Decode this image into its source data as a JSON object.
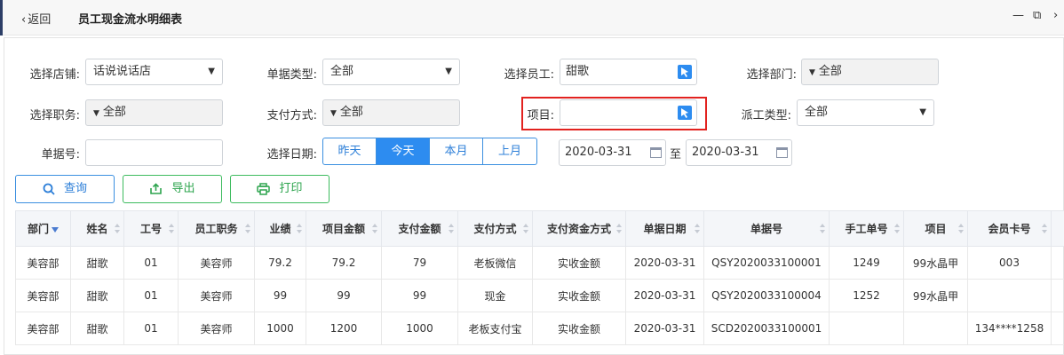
{
  "header": {
    "back_label": "返回",
    "title": "员工现金流水明细表",
    "minimize_glyph": "—",
    "restore_glyph": "⧉",
    "close_glyph": "›"
  },
  "filters": {
    "store_label": "选择店铺:",
    "store_value": "话说说话店",
    "doc_type_label": "单据类型:",
    "doc_type_value": "全部",
    "employee_label": "选择员工:",
    "employee_value": "甜歌",
    "dept_label": "选择部门:",
    "dept_value": "全部",
    "position_label": "选择职务:",
    "position_value": "全部",
    "pay_method_label": "支付方式:",
    "pay_method_value": "全部",
    "item_label": "项目:",
    "item_value": "",
    "dispatch_label": "派工类型:",
    "dispatch_value": "全部",
    "doc_no_label": "单据号:",
    "doc_no_value": "",
    "date_label": "选择日期:",
    "date_tabs": [
      "昨天",
      "今天",
      "本月",
      "上月"
    ],
    "date_active": "今天",
    "date_from": "2020-03-31",
    "date_to_sep": "至",
    "date_to": "2020-03-31",
    "accent_color": "#2d8cf0",
    "highlight_color": "#e2221f"
  },
  "actions": {
    "query_label": "查询",
    "export_label": "导出",
    "print_label": "打印"
  },
  "table": {
    "columns": [
      "部门",
      "姓名",
      "工号",
      "员工职务",
      "业绩",
      "项目金额",
      "支付金额",
      "支付方式",
      "支付资金方式",
      "单据日期",
      "单据号",
      "手工单号",
      "项目",
      "会员卡号"
    ],
    "rows": [
      [
        "美容部",
        "甜歌",
        "01",
        "美容师",
        "79.2",
        "79.2",
        "79",
        "老板微信",
        "实收金额",
        "2020-03-31",
        "QSY2020033100001",
        "1249",
        "99水晶甲",
        "003"
      ],
      [
        "美容部",
        "甜歌",
        "01",
        "美容师",
        "99",
        "99",
        "99",
        "现金",
        "实收金额",
        "2020-03-31",
        "QSY2020033100004",
        "1252",
        "99水晶甲",
        ""
      ],
      [
        "美容部",
        "甜歌",
        "01",
        "美容师",
        "1000",
        "1200",
        "1000",
        "老板支付宝",
        "实收金额",
        "2020-03-31",
        "SCD2020033100001",
        "",
        "",
        "134****1258"
      ]
    ]
  }
}
